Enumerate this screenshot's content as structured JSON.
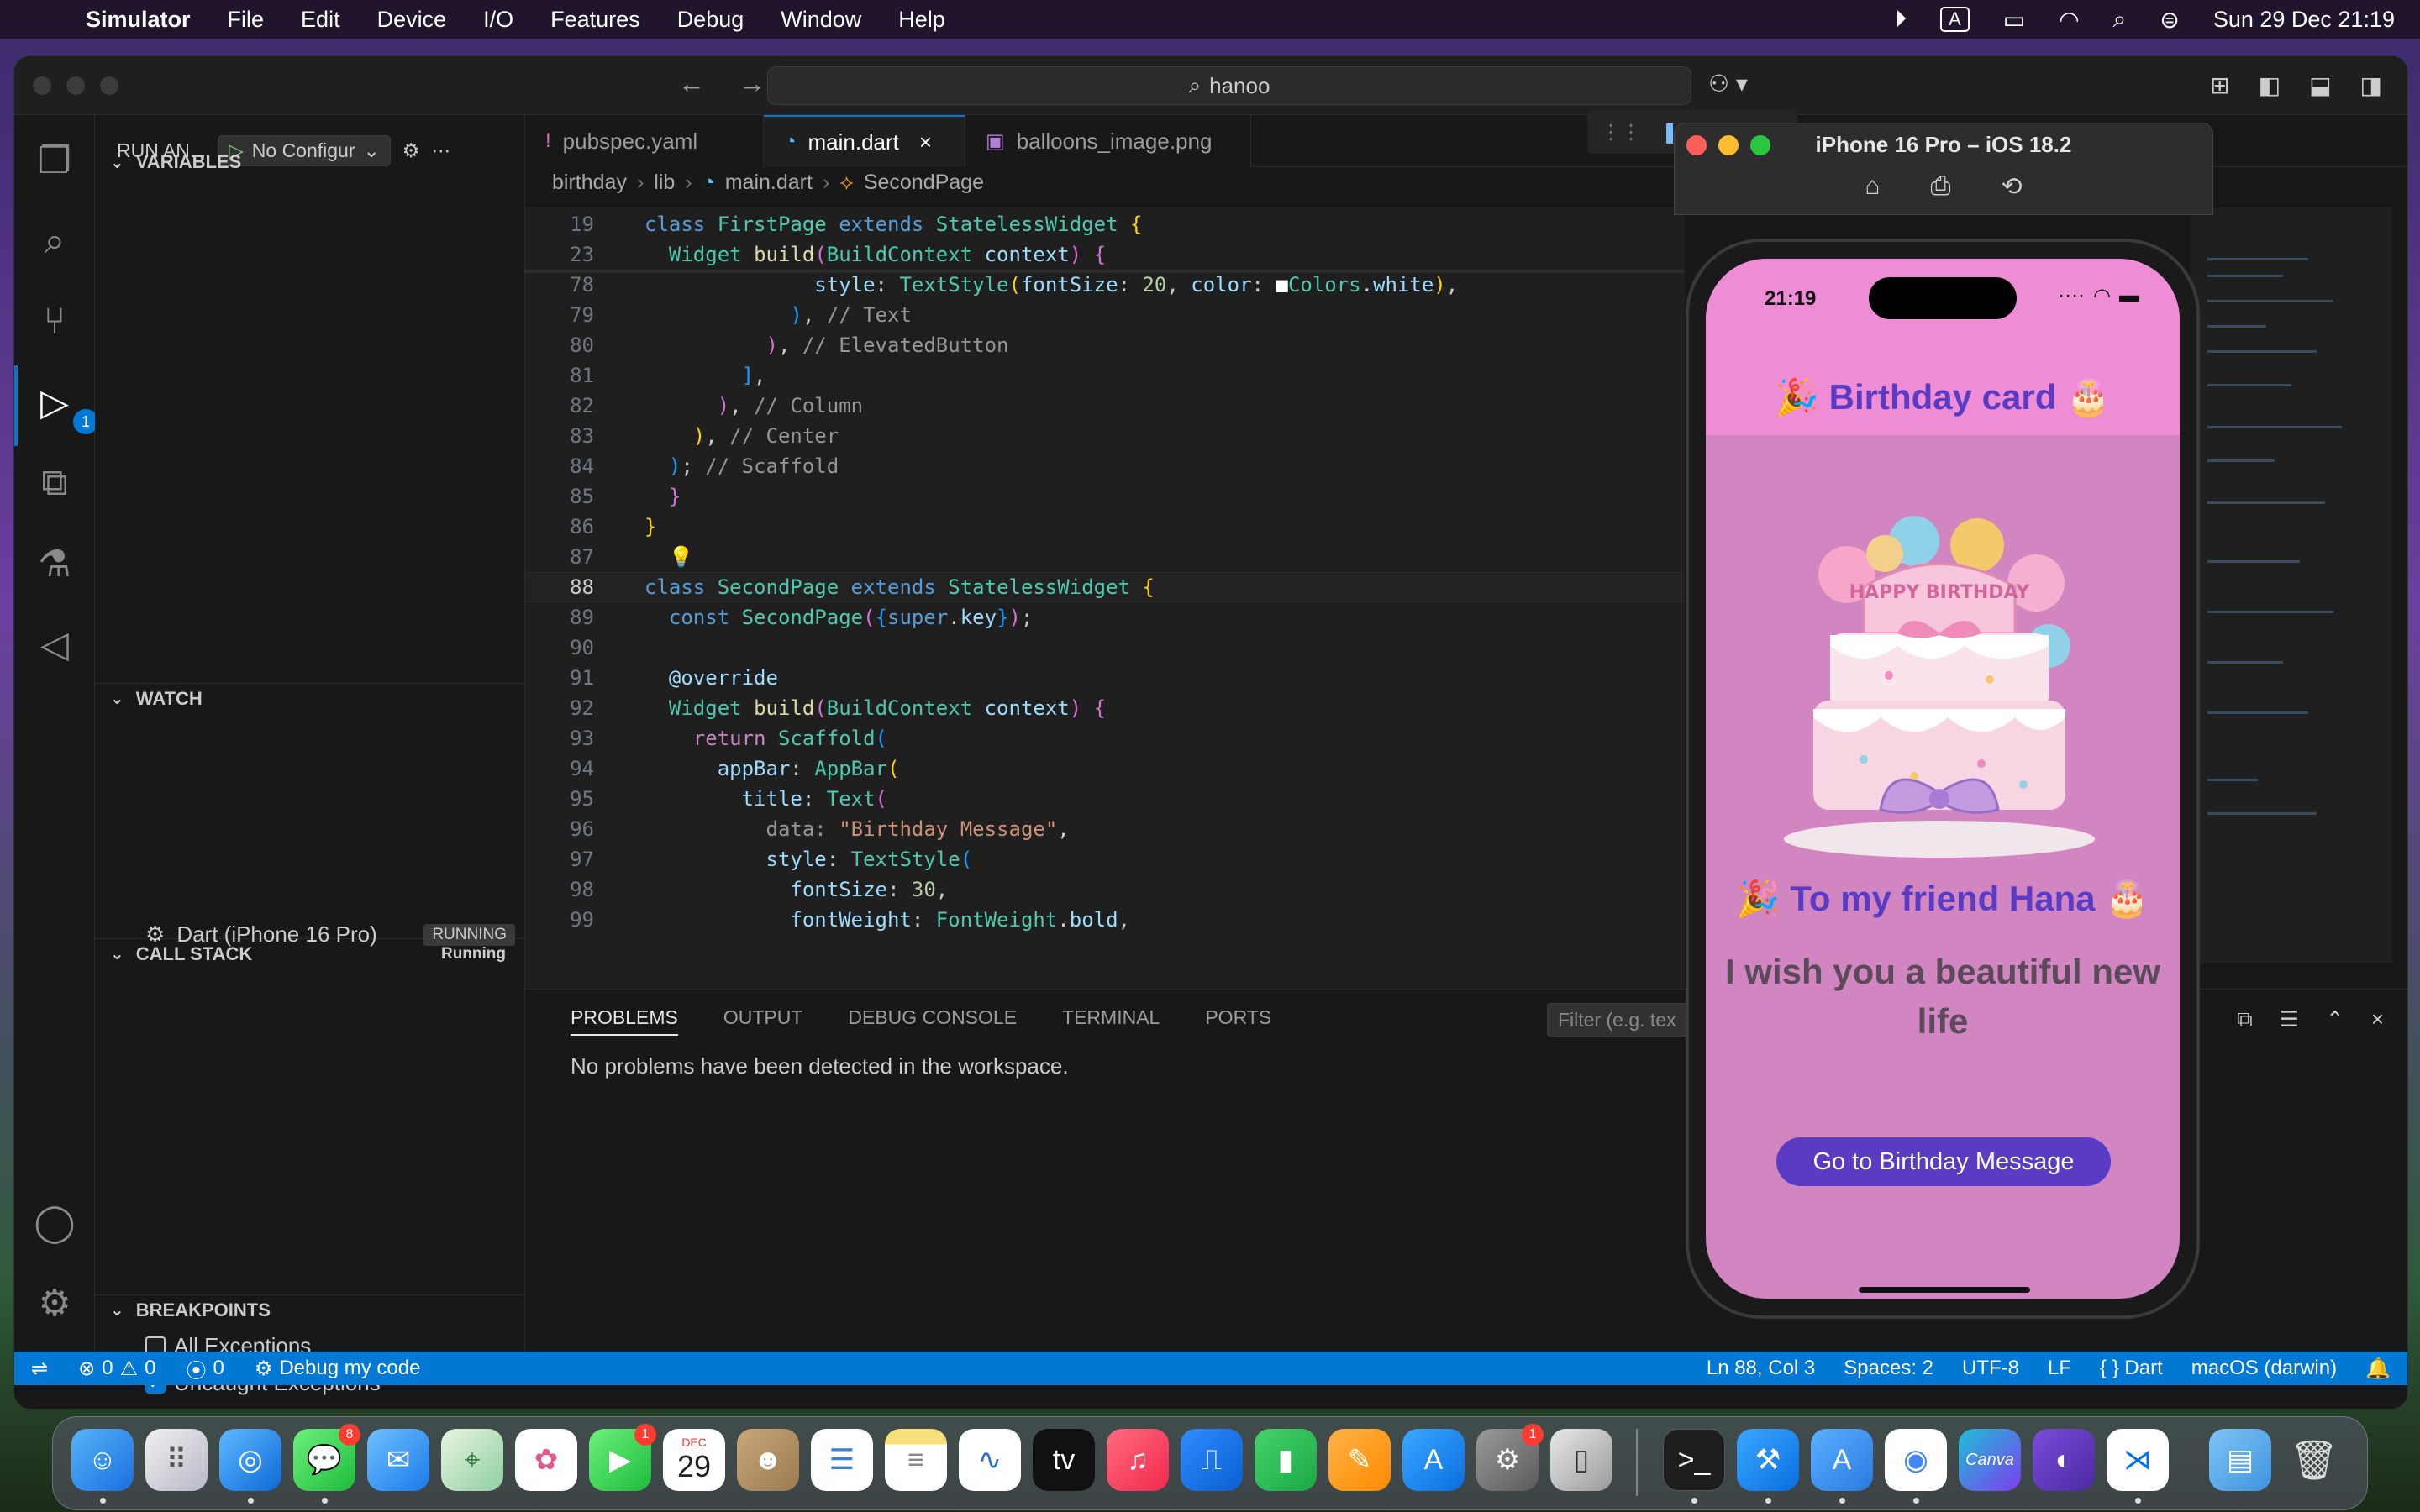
{
  "menubar": {
    "app_name": "Simulator",
    "items": [
      "File",
      "Edit",
      "Device",
      "I/O",
      "Features",
      "Debug",
      "Window",
      "Help"
    ],
    "input_indicator": "A",
    "datetime": "Sun 29 Dec  21:19"
  },
  "vscode": {
    "search_text": "hanoo",
    "run_view_title": "RUN AN...",
    "config_label": "No Configur",
    "sections": {
      "variables": "VARIABLES",
      "watch": "WATCH",
      "call_stack": "CALL STACK",
      "call_stack_status": "Running",
      "breakpoints": "BREAKPOINTS"
    },
    "call_stack_item": "Dart (iPhone 16 Pro)",
    "call_stack_item_status": "RUNNING",
    "breakpoints": [
      {
        "label": "All Exceptions",
        "checked": false
      },
      {
        "label": "Uncaught Exceptions",
        "checked": true
      }
    ],
    "debug_badge": "1",
    "tabs": [
      {
        "label": "pubspec.yaml",
        "icon": "!"
      },
      {
        "label": "main.dart",
        "icon": "◔"
      },
      {
        "label": "balloons_image.png",
        "icon": "▣"
      }
    ],
    "breadcrumb": [
      "birthday",
      "lib",
      "main.dart",
      "SecondPage"
    ],
    "code_lines": [
      {
        "n": "19"
      },
      {
        "n": "23"
      },
      {
        "n": "78"
      },
      {
        "n": "79"
      },
      {
        "n": "80"
      },
      {
        "n": "81"
      },
      {
        "n": "82"
      },
      {
        "n": "83"
      },
      {
        "n": "84"
      },
      {
        "n": "85"
      },
      {
        "n": "86"
      },
      {
        "n": "87"
      },
      {
        "n": "88"
      },
      {
        "n": "89"
      },
      {
        "n": "90"
      },
      {
        "n": "91"
      },
      {
        "n": "92"
      },
      {
        "n": "93"
      },
      {
        "n": "94"
      },
      {
        "n": "95"
      },
      {
        "n": "96"
      },
      {
        "n": "97"
      },
      {
        "n": "98"
      },
      {
        "n": "99"
      }
    ],
    "panel_tabs": [
      "PROBLEMS",
      "OUTPUT",
      "DEBUG CONSOLE",
      "TERMINAL",
      "PORTS"
    ],
    "panel_filter_placeholder": "Filter (e.g. tex",
    "panel_message": "No problems have been detected in the workspace.",
    "status": {
      "errors": "0",
      "warnings": "0",
      "ports": "0",
      "debug_label": "Debug my code",
      "position": "Ln 88, Col 3",
      "spaces": "Spaces: 2",
      "encoding": "UTF-8",
      "eol": "LF",
      "language": "Dart",
      "platform": "macOS (darwin)"
    }
  },
  "simulator": {
    "title": "iPhone 16 Pro – iOS 18.2",
    "time": "21:19",
    "app_bar_title": "🎉 Birthday card 🎂",
    "cake_text": "HAPPY BIRTHDAY",
    "friend_line": "🎉 To my friend Hana 🎂",
    "wish_line": "I wish you a beautiful new life",
    "button_label": "Go to Birthday Message"
  },
  "dock": {
    "calendar_month": "DEC",
    "calendar_day": "29",
    "badges": {
      "messages": "8",
      "facetime": "1",
      "settings": "1"
    },
    "canva_label": "Canva"
  }
}
